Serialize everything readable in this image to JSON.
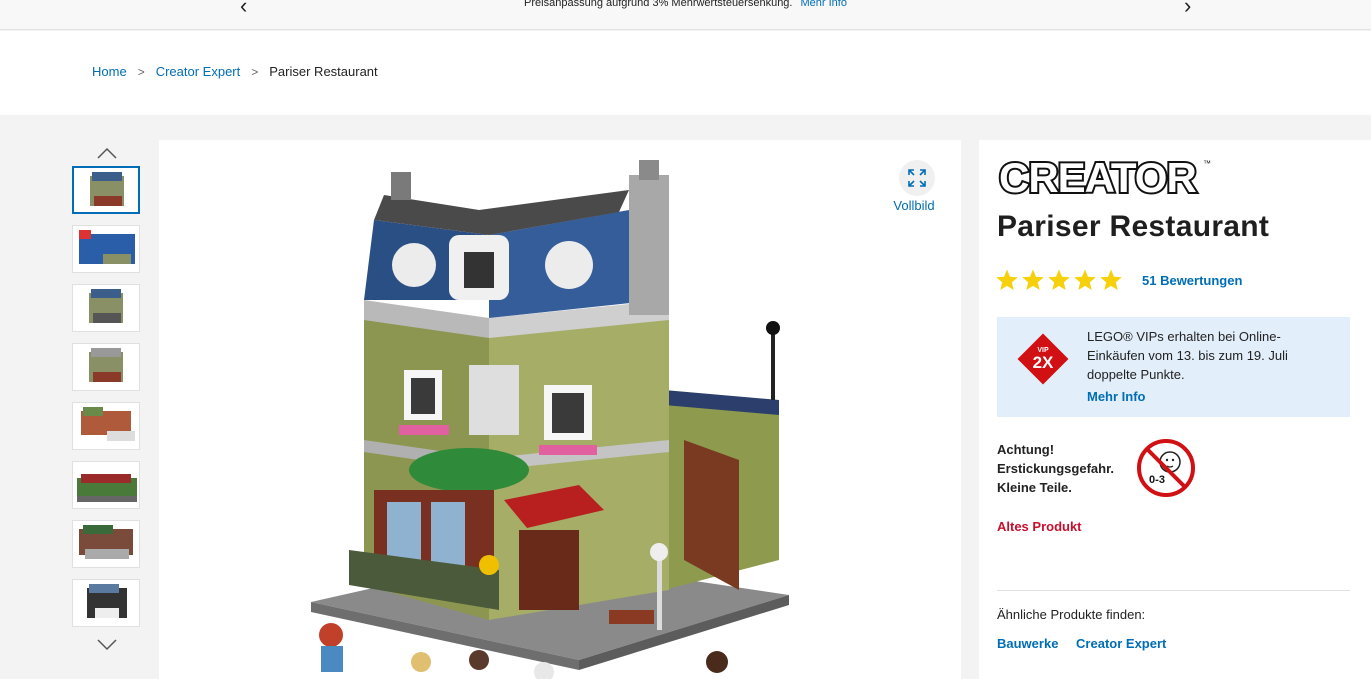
{
  "banner": {
    "message": "Preisanpassung aufgrund 3% Mehrwertsteuersenkung.",
    "link": "Mehr Info"
  },
  "breadcrumb": {
    "home": "Home",
    "category": "Creator Expert",
    "current": "Pariser Restaurant"
  },
  "gallery": {
    "thumbnail_count": 8,
    "active_index": 0,
    "fullscreen_label": "Vollbild"
  },
  "product": {
    "brand_logo": "CREATOR",
    "title": "Pariser Restaurant",
    "rating": 5,
    "rating_max": 5,
    "reviews": "51 Bewertungen",
    "vip": {
      "badge_top": "VIP",
      "badge_main": "2X",
      "text": "LEGO® VIPs erhalten bei Online-Einkäufen vom 13. bis zum 19. Juli doppelte Punkte.",
      "link": "Mehr Info"
    },
    "warning": {
      "line1": "Achtung!",
      "line2": "Erstickungsgefahr.",
      "line3": "Kleine Teile.",
      "icon_label": "0-3"
    },
    "status": "Altes Produkt",
    "similar_label": "Ähnliche Produkte finden:",
    "tags": [
      "Bauwerke",
      "Creator Expert"
    ]
  },
  "colors": {
    "link": "#006db7",
    "star": "#f6d10b",
    "status": "#c8102e",
    "vip_bg": "#e2eefa",
    "vip_badge": "#d01012"
  },
  "icons": [
    "chevron-left-icon",
    "chevron-right-icon",
    "chevron-up-icon",
    "chevron-down-icon",
    "fullscreen-icon",
    "star-icon",
    "no-small-parts-icon"
  ]
}
